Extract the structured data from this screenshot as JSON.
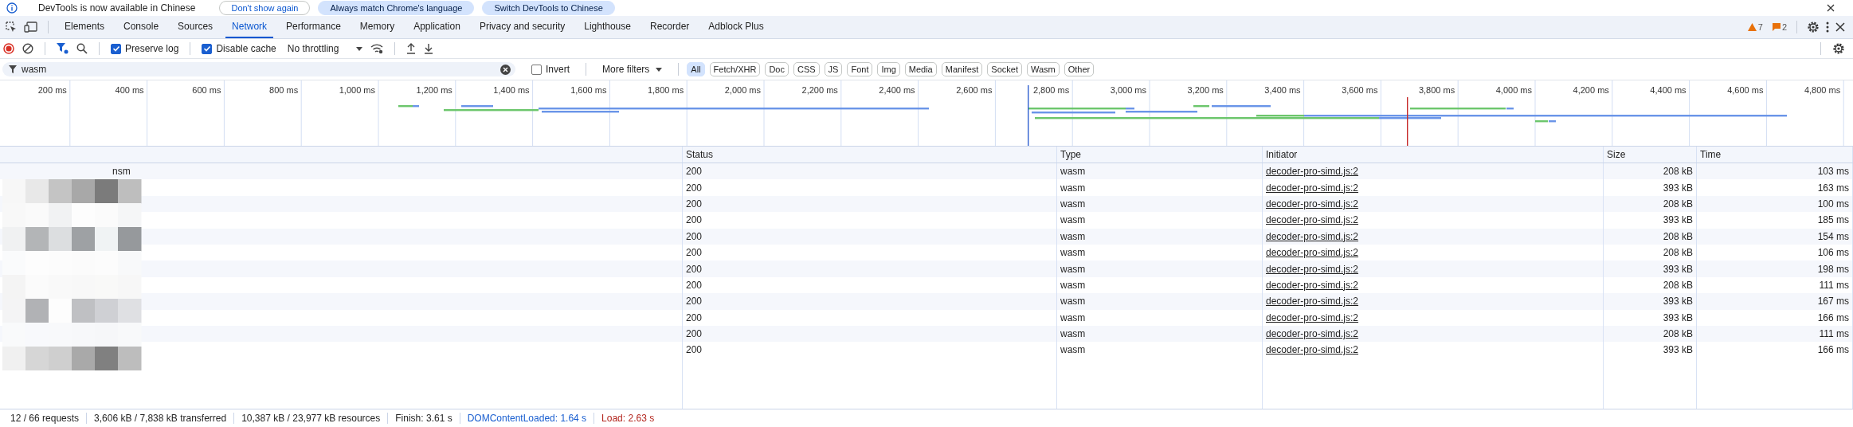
{
  "infobar": {
    "message": "DevTools is now available in Chinese",
    "buttons": [
      "Don't show again",
      "Always match Chrome's language",
      "Switch DevTools to Chinese"
    ]
  },
  "tabs": [
    {
      "label": "Elements",
      "selected": false
    },
    {
      "label": "Console",
      "selected": false
    },
    {
      "label": "Sources",
      "selected": false
    },
    {
      "label": "Network",
      "selected": true
    },
    {
      "label": "Performance",
      "selected": false
    },
    {
      "label": "Memory",
      "selected": false
    },
    {
      "label": "Application",
      "selected": false
    },
    {
      "label": "Privacy and security",
      "selected": false
    },
    {
      "label": "Lighthouse",
      "selected": false
    },
    {
      "label": "Recorder",
      "selected": false
    },
    {
      "label": "Adblock Plus",
      "selected": false
    }
  ],
  "counters": {
    "warnings": "7",
    "issues": "2"
  },
  "toolbar": {
    "preserve_log": {
      "label": "Preserve log",
      "checked": true
    },
    "disable_cache": {
      "label": "Disable cache",
      "checked": true
    },
    "throttling": "No throttling"
  },
  "filter": {
    "value": "wasm",
    "invert": {
      "label": "Invert",
      "checked": false
    },
    "more_filters": "More filters",
    "types": [
      {
        "label": "All",
        "selected": true
      },
      {
        "label": "Fetch/XHR",
        "selected": false
      },
      {
        "label": "Doc",
        "selected": false
      },
      {
        "label": "CSS",
        "selected": false
      },
      {
        "label": "JS",
        "selected": false
      },
      {
        "label": "Font",
        "selected": false
      },
      {
        "label": "Img",
        "selected": false
      },
      {
        "label": "Media",
        "selected": false
      },
      {
        "label": "Manifest",
        "selected": false
      },
      {
        "label": "Socket",
        "selected": false
      },
      {
        "label": "Wasm",
        "selected": false
      },
      {
        "label": "Other",
        "selected": false
      }
    ]
  },
  "timeline": {
    "ticks": [
      "200 ms",
      "400 ms",
      "600 ms",
      "800 ms",
      "1,000 ms",
      "1,200 ms",
      "1,400 ms",
      "1,600 ms",
      "1,800 ms",
      "2,000 ms",
      "2,200 ms",
      "2,400 ms",
      "2,600 ms",
      "2,800 ms",
      "3,000 ms",
      "3,200 ms",
      "3,400 ms",
      "3,600 ms",
      "3,800 ms",
      "4,000 ms",
      "4,200 ms",
      "4,400 ms",
      "4,600 ms",
      "4,800 ms"
    ]
  },
  "table": {
    "columns": [
      "Status",
      "Type",
      "Initiator",
      "Size",
      "Time"
    ],
    "rows": [
      {
        "name": "nsm",
        "status": "200",
        "type": "wasm",
        "initiator": "decoder-pro-simd.js:2",
        "size": "208 kB",
        "time": "103 ms"
      },
      {
        "status": "200",
        "type": "wasm",
        "initiator": "decoder-pro-simd.js:2",
        "size": "393 kB",
        "time": "163 ms"
      },
      {
        "status": "200",
        "type": "wasm",
        "initiator": "decoder-pro-simd.js:2",
        "size": "208 kB",
        "time": "100 ms"
      },
      {
        "status": "200",
        "type": "wasm",
        "initiator": "decoder-pro-simd.js:2",
        "size": "393 kB",
        "time": "185 ms"
      },
      {
        "status": "200",
        "type": "wasm",
        "initiator": "decoder-pro-simd.js:2",
        "size": "208 kB",
        "time": "154 ms"
      },
      {
        "status": "200",
        "type": "wasm",
        "initiator": "decoder-pro-simd.js:2",
        "size": "208 kB",
        "time": "106 ms"
      },
      {
        "status": "200",
        "type": "wasm",
        "initiator": "decoder-pro-simd.js:2",
        "size": "393 kB",
        "time": "198 ms"
      },
      {
        "status": "200",
        "type": "wasm",
        "initiator": "decoder-pro-simd.js:2",
        "size": "208 kB",
        "time": "111 ms"
      },
      {
        "status": "200",
        "type": "wasm",
        "initiator": "decoder-pro-simd.js:2",
        "size": "393 kB",
        "time": "167 ms"
      },
      {
        "status": "200",
        "type": "wasm",
        "initiator": "decoder-pro-simd.js:2",
        "size": "393 kB",
        "time": "166 ms"
      },
      {
        "status": "200",
        "type": "wasm",
        "initiator": "decoder-pro-simd.js:2",
        "size": "208 kB",
        "time": "111 ms"
      },
      {
        "status": "200",
        "type": "wasm",
        "initiator": "decoder-pro-simd.js:2",
        "size": "393 kB",
        "time": "166 ms"
      }
    ]
  },
  "status_bar": [
    {
      "text": "12 / 66 requests",
      "kind": "plain"
    },
    {
      "text": "3,606 kB / 7,838 kB transferred",
      "kind": "plain"
    },
    {
      "text": "10,387 kB / 23,977 kB resources",
      "kind": "plain"
    },
    {
      "text": "Finish: 3.61 s",
      "kind": "plain"
    },
    {
      "text": "DOMContentLoaded: 1.64 s",
      "kind": "dom"
    },
    {
      "text": "Load: 2.63 s",
      "kind": "load"
    }
  ]
}
